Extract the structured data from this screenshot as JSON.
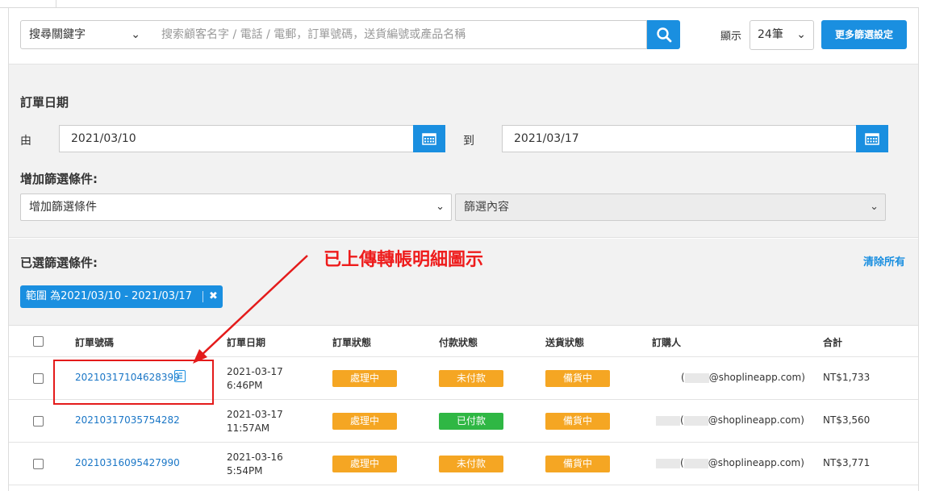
{
  "search": {
    "keyword_select": "搜尋關鍵字",
    "placeholder": "搜索顧客名字 / 電話 / 電郵，訂單號碼，送貨編號或產品名稱",
    "show_label": "顯示",
    "show_value": "24筆",
    "more_filters_label": "更多篩選設定"
  },
  "filters": {
    "order_date_title": "訂單日期",
    "from_label": "由",
    "from_value": "2021/03/10",
    "to_label": "到",
    "to_value": "2021/03/17",
    "add_condition_title": "增加篩選條件:",
    "add_condition_select": "增加篩選條件",
    "filter_content_select": "篩選內容"
  },
  "selected": {
    "title": "已選篩選條件:",
    "clear_all": "清除所有",
    "chip_label": "範圍 為2021/03/10 - 2021/03/17",
    "chip_close": "✖"
  },
  "annotation": {
    "text": "已上傳轉帳明細圖示"
  },
  "table": {
    "headers": {
      "order_no": "訂單號碼",
      "order_date": "訂單日期",
      "order_status": "訂單狀態",
      "payment_status": "付款狀態",
      "delivery_status": "送貨狀態",
      "buyer": "訂購人",
      "total": "合計"
    },
    "rows": [
      {
        "order_no": "20210317104628399",
        "date": "2021-03-17",
        "time": "6:46PM",
        "order_status": "處理中",
        "payment_status": "未付款",
        "delivery_status": "備貨中",
        "buyer_prefix": "(",
        "buyer_email": "@shoplineapp.com)",
        "total": "NT$1,733"
      },
      {
        "order_no": "20210317035754282",
        "date": "2021-03-17",
        "time": "11:57AM",
        "order_status": "處理中",
        "payment_status": "已付款",
        "delivery_status": "備貨中",
        "buyer_prefix": "(",
        "buyer_email": "@shoplineapp.com)",
        "total": "NT$3,560"
      },
      {
        "order_no": "20210316095427990",
        "date": "2021-03-16",
        "time": "5:54PM",
        "order_status": "處理中",
        "payment_status": "未付款",
        "delivery_status": "備貨中",
        "buyer_prefix": "(",
        "buyer_email": "@shoplineapp.com)",
        "total": "NT$3,771"
      }
    ]
  },
  "colors": {
    "accent": "#1a8fe0",
    "badge_orange": "#f5a623",
    "badge_green": "#2fb744",
    "annotation_red": "#ee1c1c"
  }
}
